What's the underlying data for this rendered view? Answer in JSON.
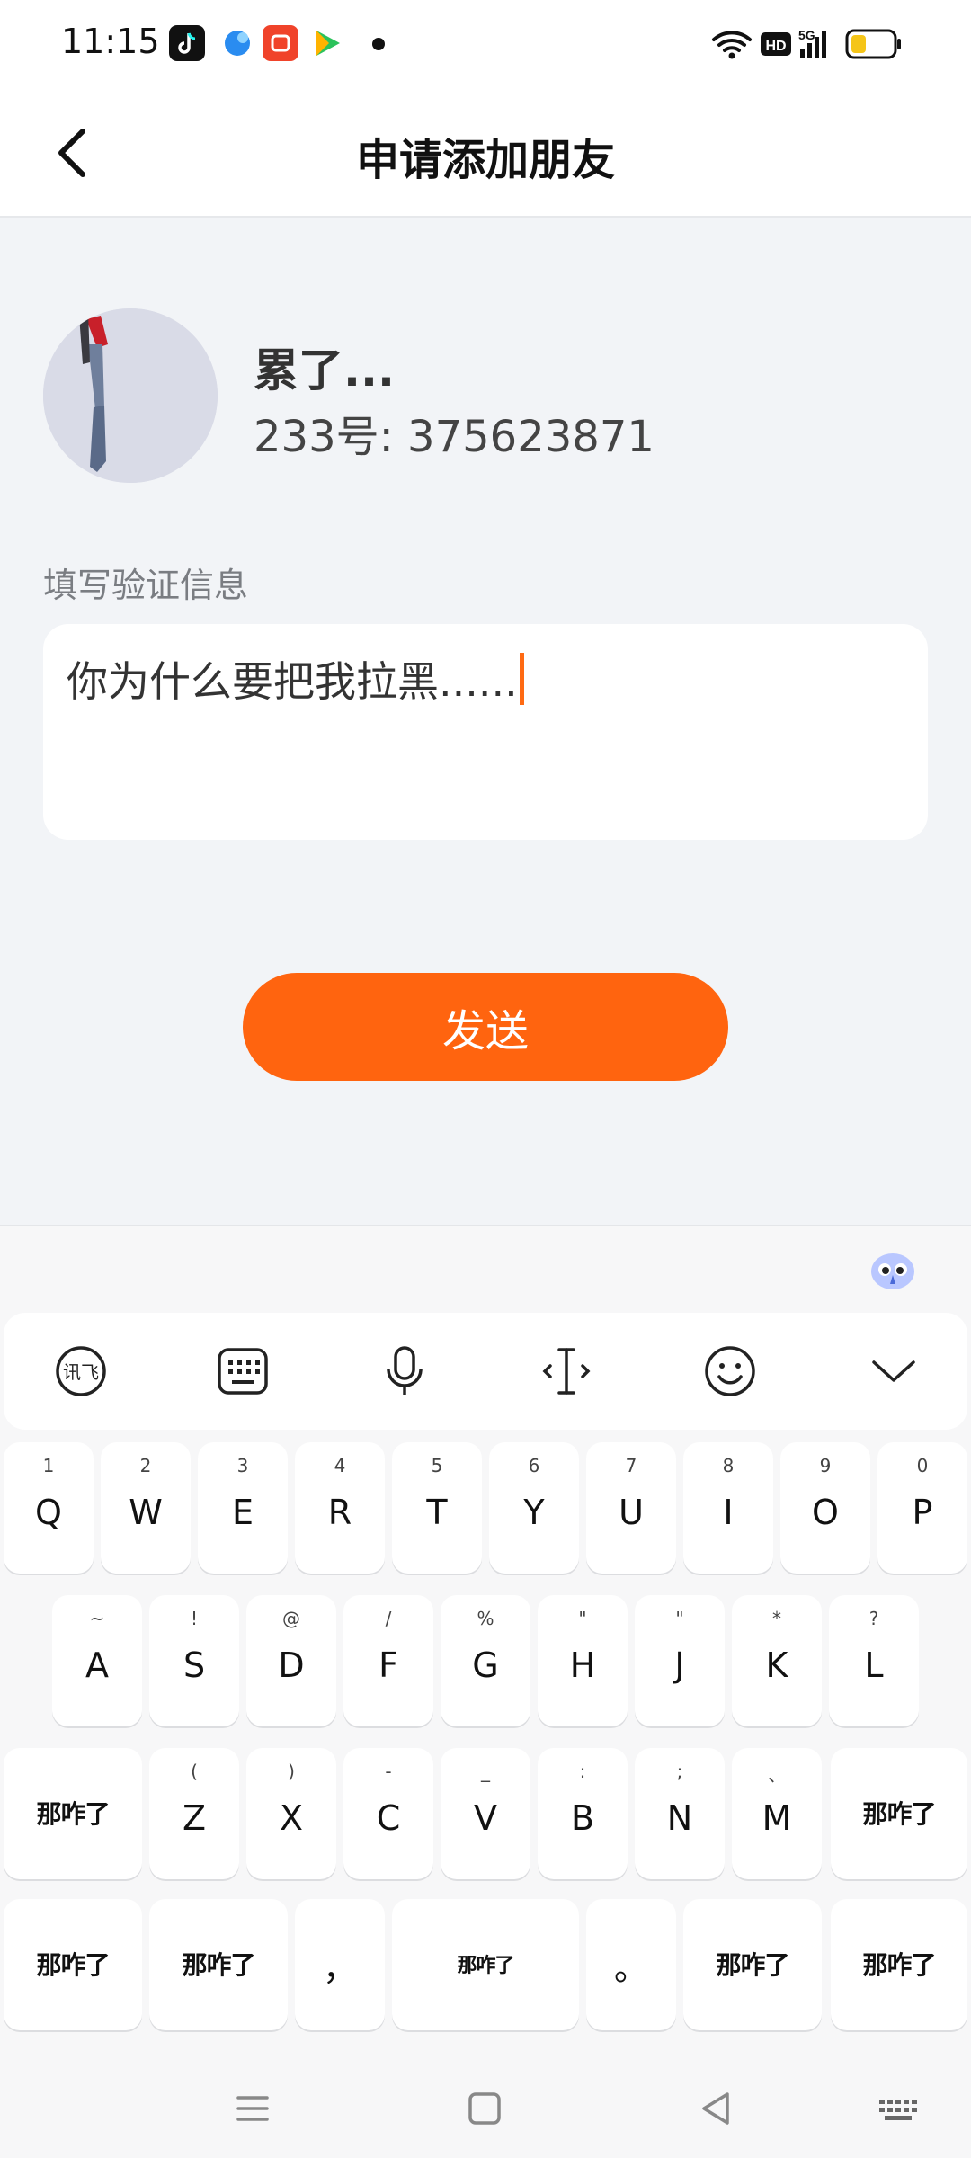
{
  "status_bar": {
    "time": "11:15"
  },
  "header": {
    "title": "申请添加朋友"
  },
  "profile": {
    "name": "累了...",
    "id_text": "233号: 375623871"
  },
  "verification": {
    "label": "填写验证信息",
    "value": "你为什么要把我拉黑......"
  },
  "send_label": "发送",
  "colors": {
    "accent": "#ff640f",
    "caret": "#ff6a13",
    "background": "#f2f4f7"
  },
  "keyboard": {
    "toolbar_icons": [
      "voice-input-icon",
      "keyboard-layout-icon",
      "microphone-icon",
      "cursor-icon",
      "emoji-icon",
      "collapse-keyboard-icon"
    ],
    "row1": [
      {
        "key": "Q",
        "hint": "1"
      },
      {
        "key": "W",
        "hint": "2"
      },
      {
        "key": "E",
        "hint": "3"
      },
      {
        "key": "R",
        "hint": "4"
      },
      {
        "key": "T",
        "hint": "5"
      },
      {
        "key": "Y",
        "hint": "6"
      },
      {
        "key": "U",
        "hint": "7"
      },
      {
        "key": "I",
        "hint": "8"
      },
      {
        "key": "O",
        "hint": "9"
      },
      {
        "key": "P",
        "hint": "0"
      }
    ],
    "row2": [
      {
        "key": "A",
        "hint": "~"
      },
      {
        "key": "S",
        "hint": "!"
      },
      {
        "key": "D",
        "hint": "@"
      },
      {
        "key": "F",
        "hint": "/"
      },
      {
        "key": "G",
        "hint": "%"
      },
      {
        "key": "H",
        "hint": "\""
      },
      {
        "key": "J",
        "hint": "\""
      },
      {
        "key": "K",
        "hint": "*"
      },
      {
        "key": "L",
        "hint": "?"
      }
    ],
    "row3": [
      {
        "key": "Z",
        "hint": "("
      },
      {
        "key": "X",
        "hint": ")"
      },
      {
        "key": "C",
        "hint": "-"
      },
      {
        "key": "V",
        "hint": "_"
      },
      {
        "key": "B",
        "hint": ":"
      },
      {
        "key": "N",
        "hint": ";"
      },
      {
        "key": "M",
        "hint": "、"
      }
    ],
    "sticker_text": "那咋了",
    "comma": "，",
    "period": "。"
  }
}
